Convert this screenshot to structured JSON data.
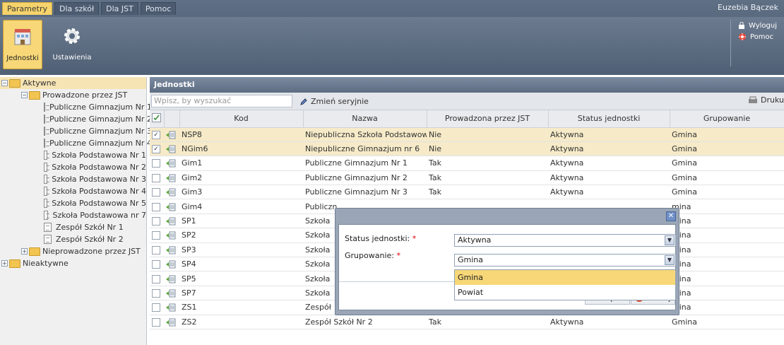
{
  "topbar": {
    "tabs": [
      {
        "label": "Parametry",
        "active": true
      },
      {
        "label": "Dla szkół",
        "active": false
      },
      {
        "label": "Dla JST",
        "active": false
      },
      {
        "label": "Pomoc",
        "active": false
      }
    ],
    "user": "Euzebia Bączek"
  },
  "ribbon": {
    "buttons": [
      {
        "label": "Jednostki",
        "icon": "building-icon"
      },
      {
        "label": "Ustawienia",
        "icon": "gear-icon"
      }
    ],
    "side": [
      {
        "label": "Wyloguj",
        "icon": "lock-icon"
      },
      {
        "label": "Pomoc",
        "icon": "lifebuoy-icon"
      }
    ]
  },
  "tree": {
    "active": "Aktywne",
    "prowadzone": "Prowadzone przez JST",
    "items": [
      "Publiczne Gimnazjum Nr 1",
      "Publiczne Gimnazjum Nr 2",
      "Publiczne Gimnazjum Nr 3",
      "Publiczne Gimnazjum Nr 4",
      "Szkoła Podstawowa Nr 1",
      "Szkoła Podstawowa Nr 2",
      "Szkoła Podstawowa Nr 3",
      "Szkoła Podstawowa Nr 4",
      "Szkoła Podstawowa Nr 5",
      "Szkoła Podstawowa nr 7",
      "Zespół Szkół Nr 1",
      "Zespół Szkół Nr 2"
    ],
    "nieprowadzone": "Nieprowadzone przez JST",
    "nieaktywne": "Nieaktywne"
  },
  "panel": {
    "title": "Jednostki",
    "search_placeholder": "Wpisz, by wyszukać",
    "zmien": "Zmień seryjnie",
    "drukuj": "Druku"
  },
  "table": {
    "columns": [
      "Kod",
      "Nazwa",
      "Prowadzona przez JST",
      "Status jednostki",
      "Grupowanie"
    ],
    "rows": [
      {
        "kod": "NSP8",
        "nazwa": "Niepubliczna Szkoła Podstawow...",
        "jst": "Nie",
        "status": "Aktywna",
        "grup": "Gmina",
        "checked": true
      },
      {
        "kod": "NGim6",
        "nazwa": "Niepubliczne Gimnazjum nr 6",
        "jst": "Nie",
        "status": "Aktywna",
        "grup": "Gmina",
        "checked": true
      },
      {
        "kod": "Gim1",
        "nazwa": "Publiczne Gimnazjum Nr 1",
        "jst": "Tak",
        "status": "Aktywna",
        "grup": "Gmina",
        "checked": false
      },
      {
        "kod": "Gim2",
        "nazwa": "Publiczne Gimnazjum Nr 2",
        "jst": "Tak",
        "status": "Aktywna",
        "grup": "Gmina",
        "checked": false
      },
      {
        "kod": "Gim3",
        "nazwa": "Publiczne Gimnazjum Nr 3",
        "jst": "Tak",
        "status": "Aktywna",
        "grup": "Gmina",
        "checked": false
      },
      {
        "kod": "Gim4",
        "nazwa": "Publiczn",
        "jst": "",
        "status": "",
        "grup": "mina",
        "checked": false
      },
      {
        "kod": "SP1",
        "nazwa": "Szkoła",
        "jst": "",
        "status": "",
        "grup": "mina",
        "checked": false
      },
      {
        "kod": "SP2",
        "nazwa": "Szkoła",
        "jst": "",
        "status": "",
        "grup": "mina",
        "checked": false
      },
      {
        "kod": "SP3",
        "nazwa": "Szkoła",
        "jst": "",
        "status": "",
        "grup": "mina",
        "checked": false
      },
      {
        "kod": "SP4",
        "nazwa": "Szkoła",
        "jst": "",
        "status": "",
        "grup": "mina",
        "checked": false
      },
      {
        "kod": "SP5",
        "nazwa": "Szkoła",
        "jst": "",
        "status": "",
        "grup": "mina",
        "checked": false
      },
      {
        "kod": "SP7",
        "nazwa": "Szkoła",
        "jst": "",
        "status": "",
        "grup": "mina",
        "checked": false
      },
      {
        "kod": "ZS1",
        "nazwa": "Zespół",
        "jst": "",
        "status": "",
        "grup": "mina",
        "checked": false
      },
      {
        "kod": "ZS2",
        "nazwa": "Zespół Szkół Nr 2",
        "jst": "Tak",
        "status": "Aktywna",
        "grup": "Gmina",
        "checked": false
      }
    ]
  },
  "dialog": {
    "status_label": "Status jednostki:",
    "status_value": "Aktywna",
    "grup_label": "Grupowanie:",
    "grup_value": "Gmina",
    "required_mark": "*",
    "options": [
      "Gmina",
      "Powiat"
    ],
    "zapisz": "Zapisz",
    "anuluj": "Anuluj"
  }
}
